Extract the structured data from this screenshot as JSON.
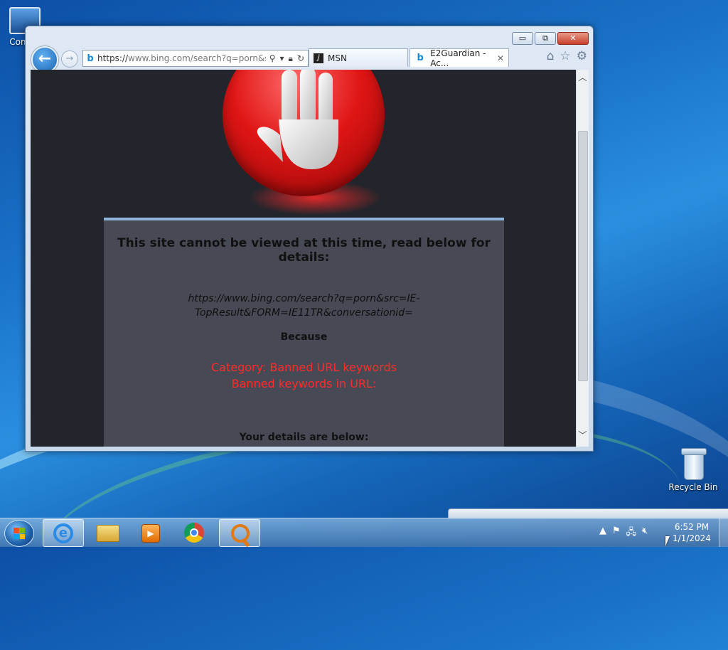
{
  "desktop": {
    "computer_label": "Com",
    "recycle_bin_label": "Recycle Bin"
  },
  "browser": {
    "address": {
      "scheme": "https://",
      "url_rest": "www.bing.com/search?q=porn&s"
    },
    "tabs": [
      {
        "label": "MSN"
      },
      {
        "label": "E2Guardian - Ac..."
      }
    ],
    "tab_close": "✕",
    "caption": {
      "minimize": "▭",
      "restore": "⧉",
      "close": "✕"
    },
    "icons": [
      "back-arrow-icon",
      "forward-arrow-icon",
      "search-icon",
      "lock-icon",
      "refresh-icon",
      "home-icon",
      "favorites-star-icon",
      "settings-gear-icon"
    ]
  },
  "page": {
    "title": "This site cannot be viewed at this time, read below for details:",
    "blocked_url": "https://www.bing.com/search?q=porn&src=IE-TopResult&FORM=IE11TR&conversationid=",
    "because_label": "Because",
    "category_line": "Category: Banned URL keywords",
    "reason_line": "Banned keywords in URL:",
    "details_heading": "Your details are below:"
  },
  "taskbar": {
    "clock_time": "6:52 PM",
    "clock_date": "1/1/2024",
    "pinned": [
      "internet-explorer",
      "windows-explorer",
      "media-player",
      "chrome",
      "search-tool"
    ]
  },
  "colors": {
    "accent_red": "#ff2a2a",
    "page_bg": "#22252b",
    "panel_bg": "#474a55"
  }
}
